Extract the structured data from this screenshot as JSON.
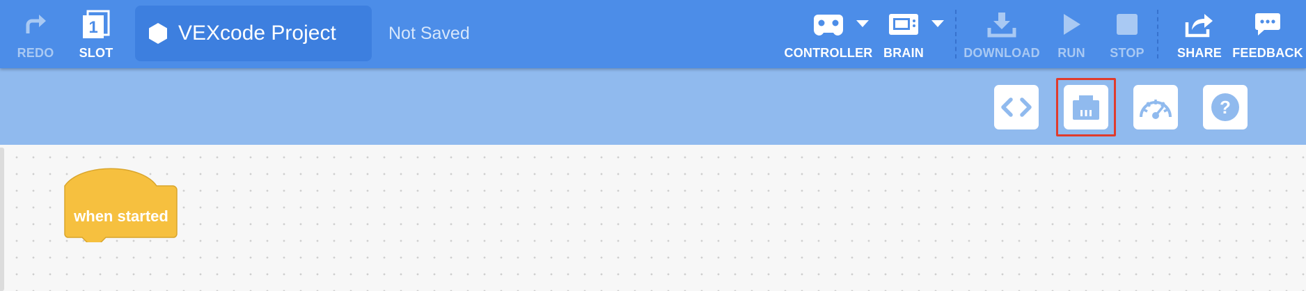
{
  "menubar": {
    "redo_label": "REDO",
    "slot_label": "SLOT",
    "slot_number": "1",
    "project_name": "VEXcode Project",
    "save_status": "Not Saved",
    "controller_label": "CONTROLLER",
    "brain_label": "BRAIN",
    "download_label": "DOWNLOAD",
    "run_label": "RUN",
    "stop_label": "STOP",
    "share_label": "SHARE",
    "feedback_label": "FEEDBACK",
    "icons": [
      "redo-icon",
      "slot-icon",
      "hexagon-icon",
      "controller-icon",
      "brain-icon",
      "download-icon",
      "run-icon",
      "stop-icon",
      "share-icon",
      "feedback-icon"
    ]
  },
  "toolbar": {
    "buttons": [
      "code-view-icon",
      "devices-icon",
      "dashboard-icon",
      "help-icon"
    ],
    "highlighted": "devices-icon",
    "help_glyph": "?"
  },
  "workspace": {
    "blocks": [
      {
        "type": "hat",
        "label": "when started",
        "color": "#f6c03f"
      }
    ]
  },
  "colors": {
    "menubar": "#4c8de8",
    "toolbar": "#90baee",
    "highlight": "#e03b2c",
    "event_block": "#f6c03f"
  }
}
